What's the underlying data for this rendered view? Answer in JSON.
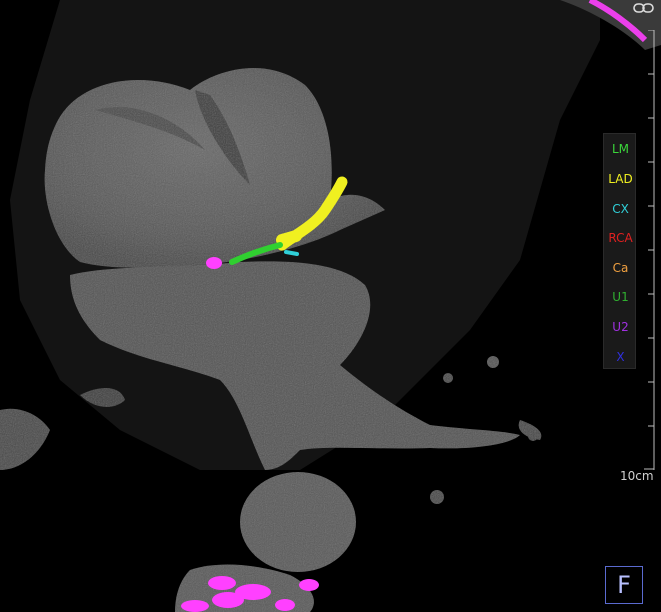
{
  "legend": {
    "items": [
      {
        "key": "lm",
        "label": "LM",
        "color": "#3ad63a"
      },
      {
        "key": "lad",
        "label": "LAD",
        "color": "#f0f020"
      },
      {
        "key": "cx",
        "label": "CX",
        "color": "#30d0d8"
      },
      {
        "key": "rca",
        "label": "RCA",
        "color": "#e02020"
      },
      {
        "key": "ca",
        "label": "Ca",
        "color": "#f0a040"
      },
      {
        "key": "u1",
        "label": "U1",
        "color": "#30b030"
      },
      {
        "key": "u2",
        "label": "U2",
        "color": "#a030e0"
      },
      {
        "key": "x",
        "label": "X",
        "color": "#3030e0"
      }
    ]
  },
  "scale": {
    "label": "10cm"
  },
  "orientation": {
    "letter": "F",
    "border_color": "#5a6ad0"
  },
  "overlay_colors": {
    "calcium": "#ff40ff",
    "lm": "#30d030",
    "lad": "#f0f020",
    "cx": "#30d0d8"
  },
  "toolbar": {
    "link_icon": "link-icon"
  }
}
